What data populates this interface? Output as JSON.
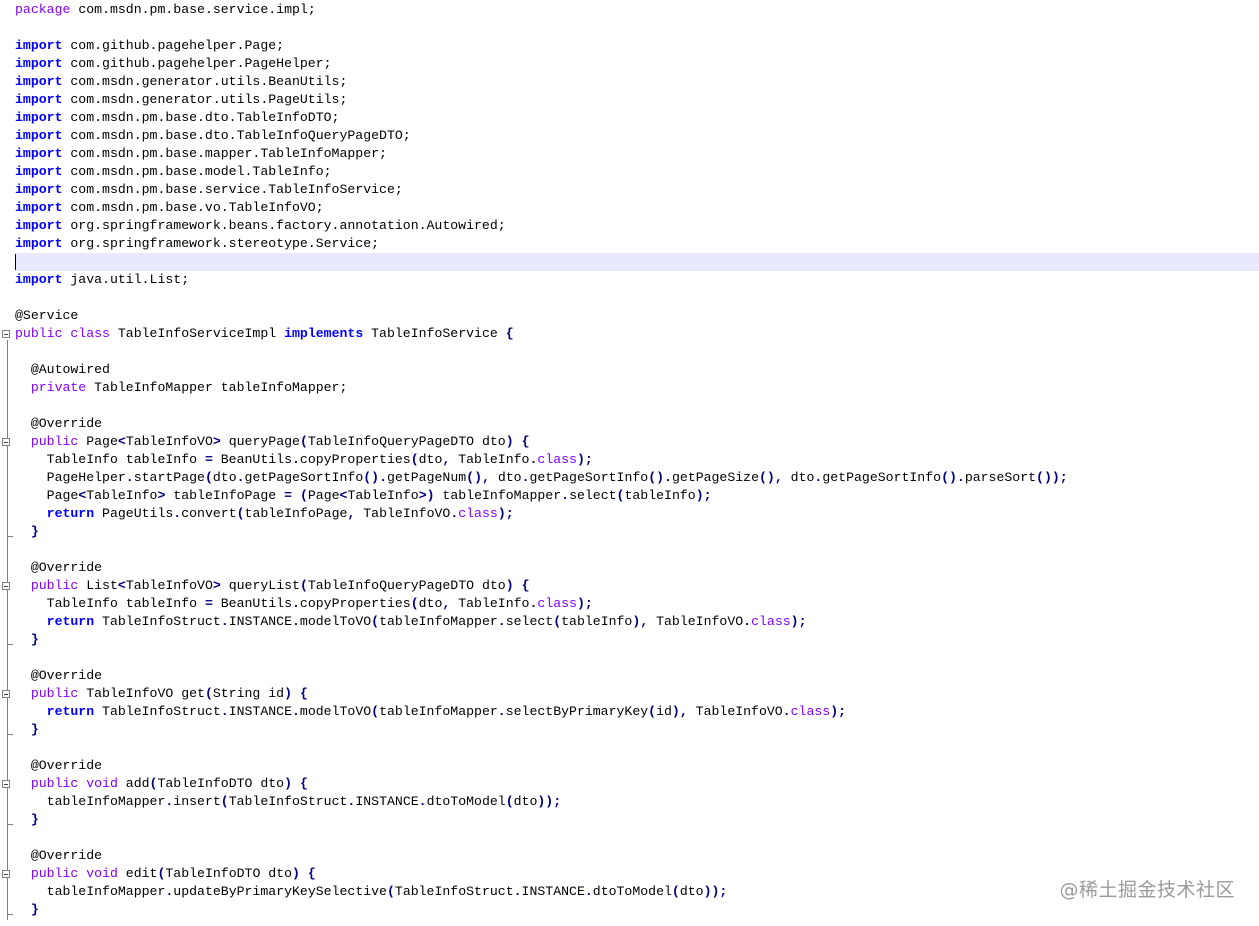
{
  "editor": {
    "lines": [
      [
        [
          "mod",
          "package"
        ],
        [
          "",
          "  com.msdn.pm.base.service.impl;"
        ]
      ],
      [],
      [
        [
          "kw",
          "import"
        ],
        [
          "",
          "  com.github.pagehelper.Page;"
        ]
      ],
      [
        [
          "kw",
          "import"
        ],
        [
          "",
          "  com.github.pagehelper.PageHelper;"
        ]
      ],
      [
        [
          "kw",
          "import"
        ],
        [
          "",
          "  com.msdn.generator.utils.BeanUtils;"
        ]
      ],
      [
        [
          "kw",
          "import"
        ],
        [
          "",
          "  com.msdn.generator.utils.PageUtils;"
        ]
      ],
      [
        [
          "kw",
          "import"
        ],
        [
          "",
          "  com.msdn.pm.base.dto.TableInfoDTO;"
        ]
      ],
      [
        [
          "kw",
          "import"
        ],
        [
          "",
          "  com.msdn.pm.base.dto.TableInfoQueryPageDTO;"
        ]
      ],
      [
        [
          "kw",
          "import"
        ],
        [
          "",
          "  com.msdn.pm.base.mapper.TableInfoMapper;"
        ]
      ],
      [
        [
          "kw",
          "import"
        ],
        [
          "",
          "  com.msdn.pm.base.model.TableInfo;"
        ]
      ],
      [
        [
          "kw",
          "import"
        ],
        [
          "",
          "  com.msdn.pm.base.service.TableInfoService;"
        ]
      ],
      [
        [
          "kw",
          "import"
        ],
        [
          "",
          "  com.msdn.pm.base.vo.TableInfoVO;"
        ]
      ],
      [
        [
          "kw",
          "import"
        ],
        [
          "",
          "  org.springframework.beans.factory.annotation.Autowired;"
        ]
      ],
      [
        [
          "kw",
          "import"
        ],
        [
          "",
          "  org.springframework.stereotype.Service;"
        ]
      ],
      [],
      [
        [
          "kw",
          "import"
        ],
        [
          "",
          "  java.util.List;"
        ]
      ],
      [],
      [
        [
          "ann",
          "@Service"
        ]
      ],
      [
        [
          "mod",
          "public"
        ],
        [
          "",
          " "
        ],
        [
          "mod",
          "class"
        ],
        [
          "",
          "  TableInfoServiceImpl "
        ],
        [
          "kw",
          "implements"
        ],
        [
          "",
          "  TableInfoService "
        ],
        [
          "op",
          "{"
        ]
      ],
      [],
      [
        [
          "",
          ""
        ],
        [
          "ann",
          "    @Autowired"
        ]
      ],
      [
        [
          "",
          "    "
        ],
        [
          "mod",
          "private"
        ],
        [
          "",
          "  TableInfoMapper tableInfoMapper;"
        ]
      ],
      [],
      [
        [
          "ann",
          "    @Override"
        ]
      ],
      [
        [
          "",
          "    "
        ],
        [
          "mod",
          "public"
        ],
        [
          "",
          "  Page"
        ],
        [
          "op",
          "<"
        ],
        [
          "",
          "TableInfoVO"
        ],
        [
          "op",
          ">"
        ],
        [
          "",
          "  queryPage"
        ],
        [
          "op",
          "("
        ],
        [
          "",
          "TableInfoQueryPageDTO dto"
        ],
        [
          "op",
          ")"
        ],
        [
          "",
          "  "
        ],
        [
          "op",
          "{"
        ]
      ],
      [
        [
          "",
          "        TableInfo tableInfo "
        ],
        [
          "op",
          "="
        ],
        [
          "",
          "  BeanUtils"
        ],
        [
          "op",
          "."
        ],
        [
          "",
          "copyProperties"
        ],
        [
          "op",
          "("
        ],
        [
          "",
          "dto"
        ],
        [
          "op",
          ","
        ],
        [
          "",
          "  TableInfo"
        ],
        [
          "op",
          "."
        ],
        [
          "tok-class",
          "class"
        ],
        [
          "op",
          ");"
        ]
      ],
      [
        [
          "",
          "        PageHelper"
        ],
        [
          "op",
          "."
        ],
        [
          "",
          "startPage"
        ],
        [
          "op",
          "("
        ],
        [
          "",
          "dto"
        ],
        [
          "op",
          "."
        ],
        [
          "",
          "getPageSortInfo"
        ],
        [
          "op",
          "()."
        ],
        [
          "",
          "getPageNum"
        ],
        [
          "op",
          "(),"
        ],
        [
          "",
          "  dto"
        ],
        [
          "op",
          "."
        ],
        [
          "",
          "getPageSortInfo"
        ],
        [
          "op",
          "()."
        ],
        [
          "",
          "getPageSize"
        ],
        [
          "op",
          "(),"
        ],
        [
          "",
          "  dto"
        ],
        [
          "op",
          "."
        ],
        [
          "",
          "getPageSortInfo"
        ],
        [
          "op",
          "()."
        ],
        [
          "",
          "parseSort"
        ],
        [
          "op",
          "());"
        ]
      ],
      [
        [
          "",
          "        Page"
        ],
        [
          "op",
          "<"
        ],
        [
          "",
          "TableInfo"
        ],
        [
          "op",
          ">"
        ],
        [
          "",
          "  tableInfoPage "
        ],
        [
          "op",
          "="
        ],
        [
          "",
          "  "
        ],
        [
          "op",
          "("
        ],
        [
          "",
          "Page"
        ],
        [
          "op",
          "<"
        ],
        [
          "",
          "TableInfo"
        ],
        [
          "op",
          ">)"
        ],
        [
          "",
          "  tableInfoMapper"
        ],
        [
          "op",
          "."
        ],
        [
          "",
          "select"
        ],
        [
          "op",
          "("
        ],
        [
          "",
          "tableInfo"
        ],
        [
          "op",
          ");"
        ]
      ],
      [
        [
          "",
          "        "
        ],
        [
          "kw",
          "return"
        ],
        [
          "",
          "  PageUtils"
        ],
        [
          "op",
          "."
        ],
        [
          "",
          "convert"
        ],
        [
          "op",
          "("
        ],
        [
          "",
          "tableInfoPage"
        ],
        [
          "op",
          ","
        ],
        [
          "",
          "  TableInfoVO"
        ],
        [
          "op",
          "."
        ],
        [
          "tok-class",
          "class"
        ],
        [
          "op",
          ");"
        ]
      ],
      [
        [
          "",
          "    "
        ],
        [
          "op",
          "}"
        ]
      ],
      [],
      [
        [
          "ann",
          "    @Override"
        ]
      ],
      [
        [
          "",
          "    "
        ],
        [
          "mod",
          "public"
        ],
        [
          "",
          "  List"
        ],
        [
          "op",
          "<"
        ],
        [
          "",
          "TableInfoVO"
        ],
        [
          "op",
          ">"
        ],
        [
          "",
          "  queryList"
        ],
        [
          "op",
          "("
        ],
        [
          "",
          "TableInfoQueryPageDTO dto"
        ],
        [
          "op",
          ")"
        ],
        [
          "",
          "  "
        ],
        [
          "op",
          "{"
        ]
      ],
      [
        [
          "",
          "        TableInfo tableInfo "
        ],
        [
          "op",
          "="
        ],
        [
          "",
          "  BeanUtils"
        ],
        [
          "op",
          "."
        ],
        [
          "",
          "copyProperties"
        ],
        [
          "op",
          "("
        ],
        [
          "",
          "dto"
        ],
        [
          "op",
          ","
        ],
        [
          "",
          "  TableInfo"
        ],
        [
          "op",
          "."
        ],
        [
          "tok-class",
          "class"
        ],
        [
          "op",
          ");"
        ]
      ],
      [
        [
          "",
          "        "
        ],
        [
          "kw",
          "return"
        ],
        [
          "",
          "  TableInfoStruct"
        ],
        [
          "op",
          "."
        ],
        [
          "",
          "INSTANCE"
        ],
        [
          "op",
          "."
        ],
        [
          "",
          "modelToVO"
        ],
        [
          "op",
          "("
        ],
        [
          "",
          "tableInfoMapper"
        ],
        [
          "op",
          "."
        ],
        [
          "",
          "select"
        ],
        [
          "op",
          "("
        ],
        [
          "",
          "tableInfo"
        ],
        [
          "op",
          "),"
        ],
        [
          "",
          "  TableInfoVO"
        ],
        [
          "op",
          "."
        ],
        [
          "tok-class",
          "class"
        ],
        [
          "op",
          ");"
        ]
      ],
      [
        [
          "",
          "    "
        ],
        [
          "op",
          "}"
        ]
      ],
      [],
      [
        [
          "ann",
          "    @Override"
        ]
      ],
      [
        [
          "",
          "    "
        ],
        [
          "mod",
          "public"
        ],
        [
          "",
          "  TableInfoVO get"
        ],
        [
          "op",
          "("
        ],
        [
          "",
          "String id"
        ],
        [
          "op",
          ")"
        ],
        [
          "",
          "  "
        ],
        [
          "op",
          "{"
        ]
      ],
      [
        [
          "",
          "        "
        ],
        [
          "kw",
          "return"
        ],
        [
          "",
          "  TableInfoStruct"
        ],
        [
          "op",
          "."
        ],
        [
          "",
          "INSTANCE"
        ],
        [
          "op",
          "."
        ],
        [
          "",
          "modelToVO"
        ],
        [
          "op",
          "("
        ],
        [
          "",
          "tableInfoMapper"
        ],
        [
          "op",
          "."
        ],
        [
          "",
          "selectByPrimaryKey"
        ],
        [
          "op",
          "("
        ],
        [
          "",
          "id"
        ],
        [
          "op",
          "),"
        ],
        [
          "",
          "  TableInfoVO"
        ],
        [
          "op",
          "."
        ],
        [
          "tok-class",
          "class"
        ],
        [
          "op",
          ");"
        ]
      ],
      [
        [
          "",
          "    "
        ],
        [
          "op",
          "}"
        ]
      ],
      [],
      [
        [
          "ann",
          "    @Override"
        ]
      ],
      [
        [
          "",
          "    "
        ],
        [
          "mod",
          "public"
        ],
        [
          "",
          "  "
        ],
        [
          "mod",
          "void"
        ],
        [
          "",
          "  add"
        ],
        [
          "op",
          "("
        ],
        [
          "",
          "TableInfoDTO dto"
        ],
        [
          "op",
          ")"
        ],
        [
          "",
          "  "
        ],
        [
          "op",
          "{"
        ]
      ],
      [
        [
          "",
          "        tableInfoMapper"
        ],
        [
          "op",
          "."
        ],
        [
          "",
          "insert"
        ],
        [
          "op",
          "("
        ],
        [
          "",
          "TableInfoStruct"
        ],
        [
          "op",
          "."
        ],
        [
          "",
          "INSTANCE"
        ],
        [
          "op",
          "."
        ],
        [
          "",
          "dtoToModel"
        ],
        [
          "op",
          "("
        ],
        [
          "",
          "dto"
        ],
        [
          "op",
          "));"
        ]
      ],
      [
        [
          "",
          "    "
        ],
        [
          "op",
          "}"
        ]
      ],
      [],
      [
        [
          "ann",
          "    @Override"
        ]
      ],
      [
        [
          "",
          "    "
        ],
        [
          "mod",
          "public"
        ],
        [
          "",
          "  "
        ],
        [
          "mod",
          "void"
        ],
        [
          "",
          "  edit"
        ],
        [
          "op",
          "("
        ],
        [
          "",
          "TableInfoDTO dto"
        ],
        [
          "op",
          ")"
        ],
        [
          "",
          "  "
        ],
        [
          "op",
          "{"
        ]
      ],
      [
        [
          "",
          "        tableInfoMapper"
        ],
        [
          "op",
          "."
        ],
        [
          "",
          "updateByPrimaryKeySelective"
        ],
        [
          "op",
          "("
        ],
        [
          "",
          "TableInfoStruct"
        ],
        [
          "op",
          "."
        ],
        [
          "",
          "INSTANCE"
        ],
        [
          "op",
          "."
        ],
        [
          "",
          "dtoToModel"
        ],
        [
          "op",
          "("
        ],
        [
          "",
          "dto"
        ],
        [
          "op",
          "));"
        ]
      ],
      [
        [
          "",
          "    "
        ],
        [
          "op",
          "}"
        ]
      ]
    ],
    "caret_line_index": 14
  },
  "watermark": "@稀土掘金技术社区"
}
